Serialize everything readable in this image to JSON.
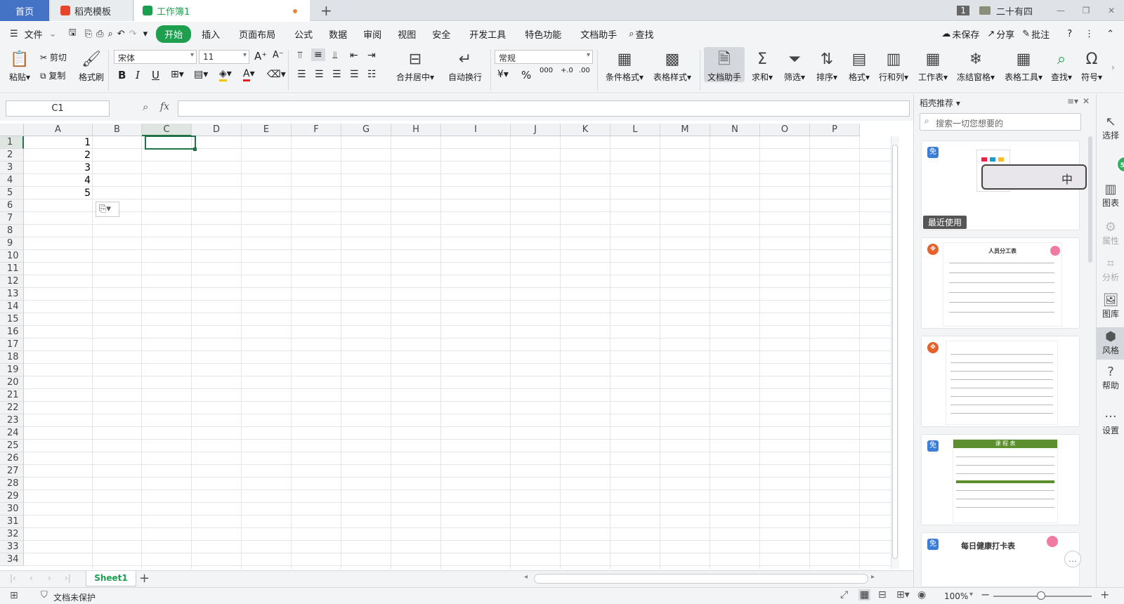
{
  "titlebar": {
    "tab_home": "首页",
    "tab_template": "稻壳模板",
    "tab_book": "工作簿1",
    "page_badge": "1",
    "user_name": "二十有四"
  },
  "menu": {
    "file": "文件",
    "items": [
      "开始",
      "插入",
      "页面布局",
      "公式",
      "数据",
      "审阅",
      "视图",
      "安全",
      "开发工具",
      "特色功能",
      "文档助手"
    ],
    "search": "查找",
    "unsaved": "未保存",
    "share": "分享",
    "comment": "批注"
  },
  "ribbon": {
    "paste": "粘贴",
    "cut": "剪切",
    "copy": "复制",
    "format_painter": "格式刷",
    "font_name": "宋体",
    "font_size": "11",
    "merge_center": "合并居中",
    "wrap": "自动换行",
    "number_format": "常规",
    "cond_format": "条件格式",
    "table_style": "表格样式",
    "doc_helper": "文档助手",
    "sum": "求和",
    "filter": "筛选",
    "sort": "排序",
    "format": "格式",
    "rows_cols": "行和列",
    "worksheet": "工作表",
    "freeze": "冻结窗格",
    "table_tools": "表格工具",
    "find": "查找",
    "symbol": "符号"
  },
  "formula_bar": {
    "name_box": "C1",
    "fx": "fx"
  },
  "grid": {
    "columns": [
      "A",
      "B",
      "C",
      "D",
      "E",
      "F",
      "G",
      "H",
      "I",
      "J",
      "K",
      "L",
      "M",
      "N",
      "O",
      "P"
    ],
    "rows": [
      "1",
      "2",
      "3",
      "4",
      "5",
      "6",
      "7",
      "8",
      "9",
      "10",
      "11",
      "12",
      "13",
      "14",
      "15",
      "16",
      "17",
      "18",
      "19",
      "20",
      "21",
      "22",
      "23",
      "24",
      "25",
      "26",
      "27",
      "28",
      "29",
      "30",
      "31",
      "32",
      "33",
      "34"
    ],
    "a_values": [
      "1",
      "2",
      "3",
      "4",
      "5"
    ]
  },
  "sheet": {
    "tab": "Sheet1"
  },
  "status": {
    "protect": "文档未保护",
    "zoom": "100%"
  },
  "panel": {
    "title": "稻壳推荐",
    "search_placeholder": "搜索一切您想要的",
    "recent_label": "最近使用",
    "free_badge": "免",
    "card2_title": "人员分工表",
    "card4_title": "课 程 表",
    "card5_title": "每日健康打卡表",
    "ime": "中"
  },
  "rightbar": {
    "items": [
      "选择",
      "图表",
      "属性",
      "分析",
      "图库",
      "风格",
      "帮助",
      "设置"
    ]
  },
  "colors": {
    "accent_green": "#1e9e4f",
    "home_blue": "#4472c4",
    "selection_green": "#217346"
  }
}
